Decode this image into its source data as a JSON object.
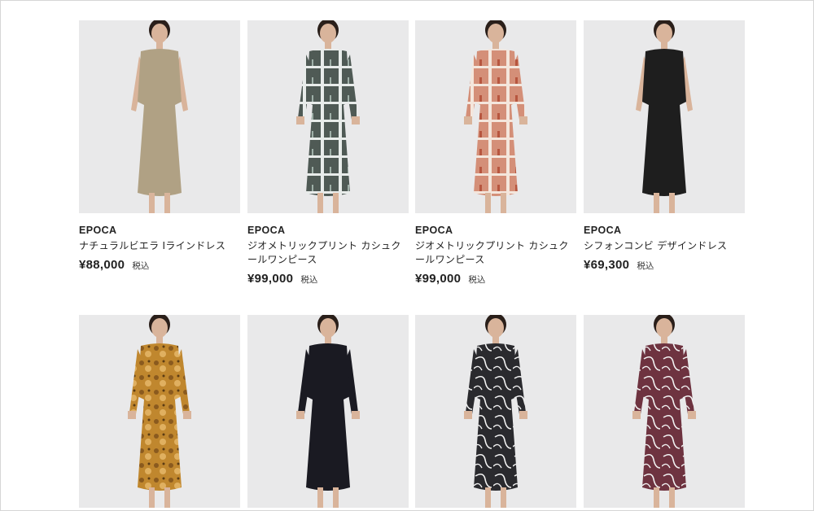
{
  "products": [
    {
      "brand": "EPOCA",
      "name": "ナチュラルビエラ Iラインドレス",
      "price": "¥88,000",
      "tax": "税込",
      "dress_color": "#b0a184",
      "pattern": "none"
    },
    {
      "brand": "EPOCA",
      "name": "ジオメトリックプリント カシュクールワンピース",
      "price": "¥99,000",
      "tax": "税込",
      "dress_color": "#4f5a55",
      "pattern": "check-dark"
    },
    {
      "brand": "EPOCA",
      "name": "ジオメトリックプリント カシュクールワンピース",
      "price": "¥99,000",
      "tax": "税込",
      "dress_color": "#d48f78",
      "pattern": "check-orange"
    },
    {
      "brand": "EPOCA",
      "name": "シフォンコンビ デザインドレス",
      "price": "¥69,300",
      "tax": "税込",
      "dress_color": "#1e1e1e",
      "pattern": "none"
    },
    {
      "brand": "",
      "name": "",
      "price": "",
      "tax": "",
      "dress_color": "#c0872e",
      "pattern": "floral"
    },
    {
      "brand": "",
      "name": "",
      "price": "",
      "tax": "",
      "dress_color": "#1a1a22",
      "pattern": "none"
    },
    {
      "brand": "",
      "name": "",
      "price": "",
      "tax": "",
      "dress_color": "#2a2a2e",
      "pattern": "swirl-white"
    },
    {
      "brand": "",
      "name": "",
      "price": "",
      "tax": "",
      "dress_color": "#6e3340",
      "pattern": "swirl-white"
    }
  ]
}
